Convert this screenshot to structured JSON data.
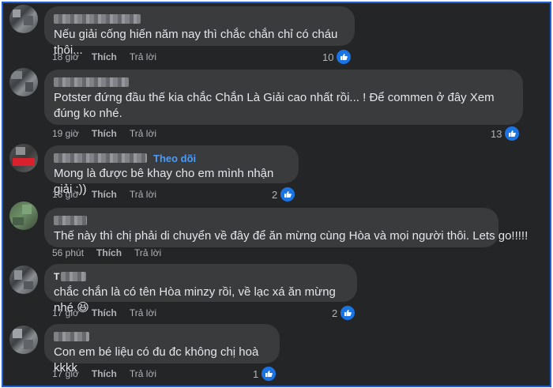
{
  "comments": [
    {
      "text": "Nếu giải cống hiến năm nay thì chắc chắn chỉ có cháu thôi...",
      "time": "18 giờ",
      "like_label": "Thích",
      "reply_label": "Trả lời",
      "reactions": "10"
    },
    {
      "text": "Potster đứng đầu thế kia chắc Chắn Là Giải cao nhất rồi... ! Để commen ở đây Xem đúng ko nhé.",
      "time": "19 giờ",
      "like_label": "Thích",
      "reply_label": "Trả lời",
      "reactions": "13"
    },
    {
      "text": "Mong là được bê khay cho em mình nhận giải :))",
      "time": "16 giờ",
      "like_label": "Thích",
      "reply_label": "Trả lời",
      "reactions": "2",
      "follow": "Theo dõi"
    },
    {
      "text": "Thế này thì chị phải di chuyển về đây để ăn mừng cùng Hòa và mọi người thôi. Lets go!!!!!",
      "time": "56 phút",
      "like_label": "Thích",
      "reply_label": "Trả lời",
      "reactions": ""
    },
    {
      "name_initial": "T",
      "text": "chắc chắn là có tên Hòa minzy rồi, về lạc xá ăn mừng nhé 😆",
      "time": "17 giờ",
      "like_label": "Thích",
      "reply_label": "Trả lời",
      "reactions": "2"
    },
    {
      "text": "Con em bé liệu có đu đc không chị hoà kkkk",
      "time": "17 giờ",
      "like_label": "Thích",
      "reply_label": "Trả lời",
      "reactions": "1"
    }
  ],
  "colors": {
    "border": "#1f5fd6",
    "background": "#242526",
    "bubble": "#3a3b3c",
    "accent": "#1b74e4"
  }
}
